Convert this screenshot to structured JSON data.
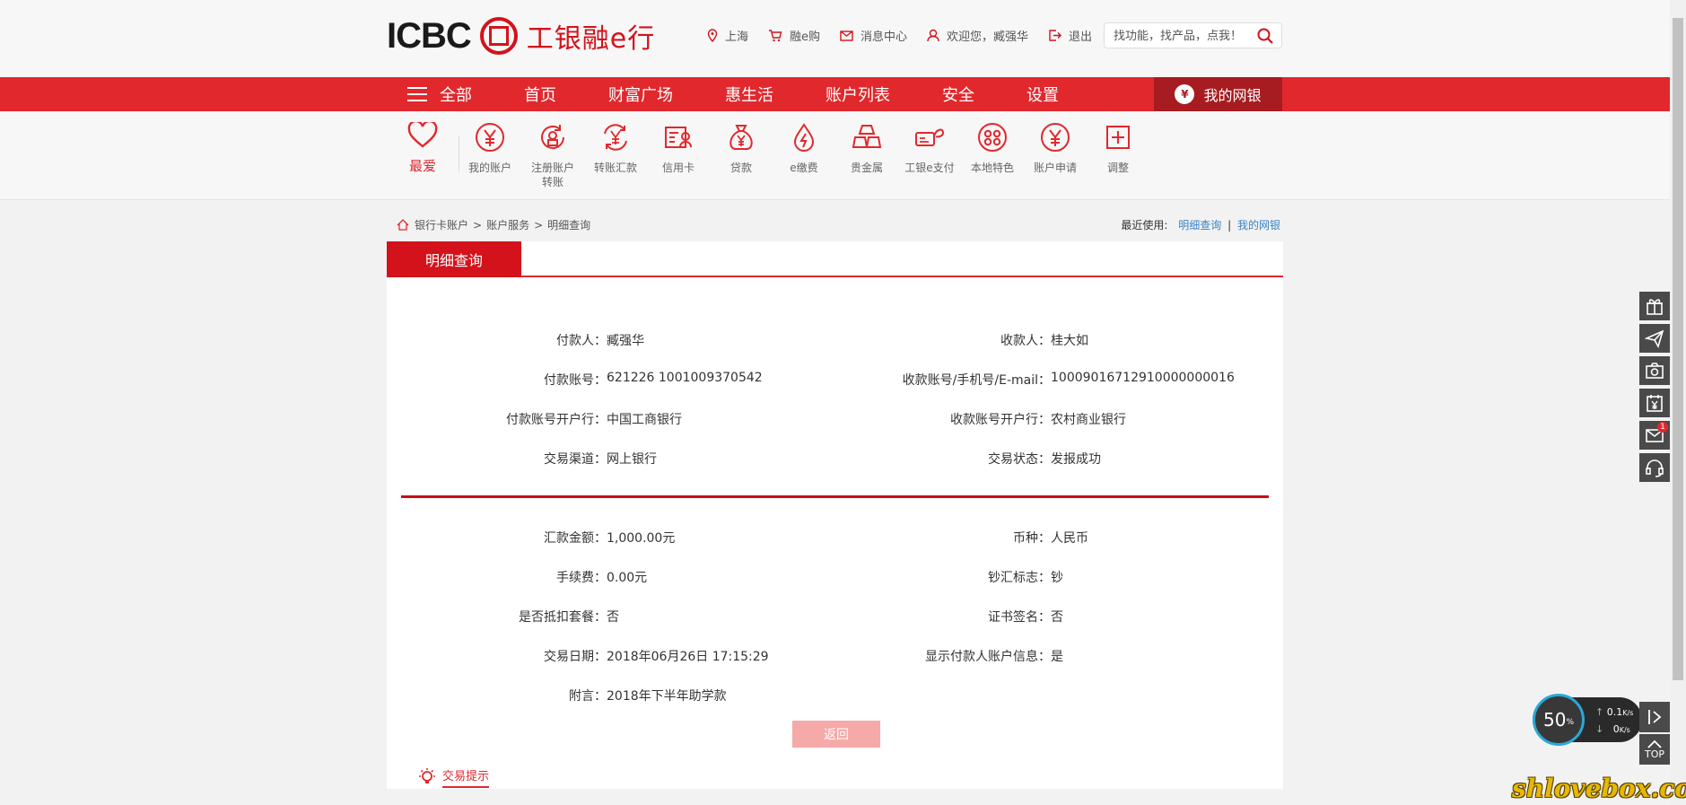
{
  "header": {
    "logo_en": "ICBC",
    "logo_cn": "工银融e行",
    "links": [
      {
        "label": "上海",
        "icon": "location-icon"
      },
      {
        "label": "融e购",
        "icon": "cart-icon"
      },
      {
        "label": "消息中心",
        "icon": "mail-icon"
      },
      {
        "label": "欢迎您，臧强华",
        "icon": "user-icon"
      },
      {
        "label": "退出",
        "icon": "logout-icon"
      }
    ],
    "search_placeholder": "找功能，找产品，点我！"
  },
  "nav": {
    "all_label": "全部",
    "items": [
      "首页",
      "财富广场",
      "惠生活",
      "账户列表",
      "安全",
      "设置"
    ],
    "mybank_label": "我的网银"
  },
  "quick": {
    "fav_label": "最爱",
    "items": [
      {
        "label1": "我的账户",
        "label2": ""
      },
      {
        "label1": "注册账户",
        "label2": "转账"
      },
      {
        "label1": "转账汇款",
        "label2": ""
      },
      {
        "label1": "信用卡",
        "label2": ""
      },
      {
        "label1": "贷款",
        "label2": ""
      },
      {
        "label1": "e缴费",
        "label2": ""
      },
      {
        "label1": "贵金属",
        "label2": ""
      },
      {
        "label1": "工银e支付",
        "label2": ""
      },
      {
        "label1": "本地特色",
        "label2": ""
      },
      {
        "label1": "账户申请",
        "label2": ""
      },
      {
        "label1": "调整",
        "label2": ""
      }
    ]
  },
  "breadcrumb": {
    "items": [
      "银行卡账户",
      "账户服务",
      "明细查询"
    ],
    "sep": ">"
  },
  "recent": {
    "label": "最近使用:",
    "links": [
      "明细查询",
      "我的网银"
    ],
    "sep": "|"
  },
  "panel": {
    "tab": "明细查询",
    "left": [
      {
        "key": "付款人：",
        "value": "臧强华"
      },
      {
        "key": "付款账号：",
        "value": "621226 1001009370542"
      },
      {
        "key": "付款账号开户行：",
        "value": "中国工商银行"
      },
      {
        "key": "交易渠道：",
        "value": "网上银行"
      }
    ],
    "right": [
      {
        "key": "收款人：",
        "value": "桂大如"
      },
      {
        "key": "收款账号/手机号/E-mail：",
        "value": "1000901671291000000001​6"
      },
      {
        "key": "收款账号开户行：",
        "value": "农村商业银行"
      },
      {
        "key": "交易状态：",
        "value": "发报成功"
      }
    ],
    "left2": [
      {
        "key": "汇款金额：",
        "value": "1,000.00元"
      },
      {
        "key": "手续费：",
        "value": "0.00元"
      },
      {
        "key": "是否抵扣套餐：",
        "value": "否"
      },
      {
        "key": "交易日期：",
        "value": "2018年06月26日 17:15:29"
      },
      {
        "key": "附言：",
        "value": "2018年下半年助学款"
      }
    ],
    "right2": [
      {
        "key": "币种：",
        "value": "人民币"
      },
      {
        "key": "钞汇标志：",
        "value": "钞"
      },
      {
        "key": "证书签名：",
        "value": "否"
      },
      {
        "key": "显示付款人账户信息：",
        "value": "是"
      }
    ],
    "back_button": "返回",
    "tips": "交易提示"
  },
  "speed": {
    "percent": "50",
    "percent_unit": "%",
    "up": "0.1",
    "down": "0",
    "unit": "K/s"
  },
  "side": {
    "badge": "1",
    "top_label": "TOP"
  },
  "watermark": "shlovebox.com"
}
